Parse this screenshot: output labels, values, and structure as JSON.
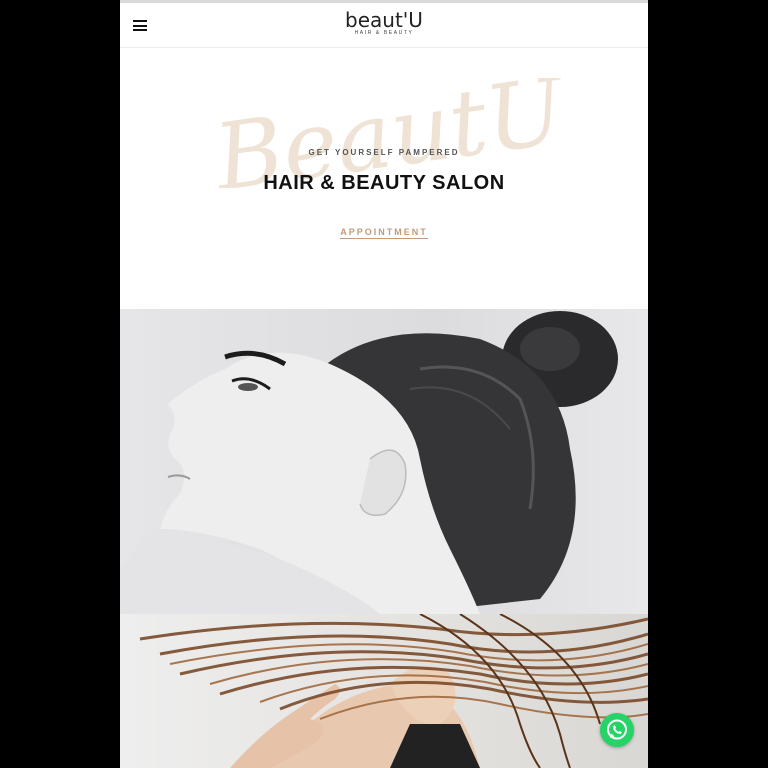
{
  "header": {
    "logo_main": "beaut'U",
    "logo_sub": "HAIR & BEAUTY",
    "menu_icon": "hamburger-menu-icon"
  },
  "hero": {
    "script_text": "BeautU",
    "tagline": "GET YOURSELF PAMPERED",
    "title": "HAIR & BEAUTY SALON",
    "cta_label": "APPOINTMENT"
  },
  "floating": {
    "whatsapp_icon": "whatsapp-icon"
  },
  "colors": {
    "accent": "#c59a7a",
    "script": "#efe3d6",
    "whatsapp": "#25d366"
  }
}
